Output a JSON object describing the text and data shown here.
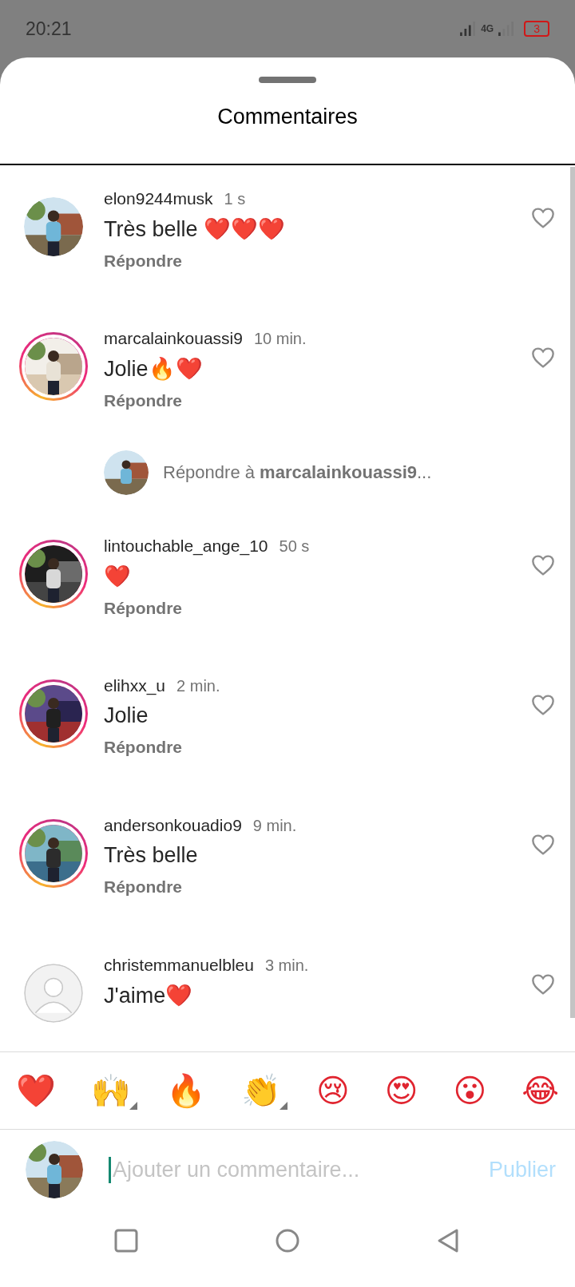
{
  "status_bar": {
    "time": "20:21",
    "network": "4G",
    "battery": "3"
  },
  "sheet": {
    "title": "Commentaires"
  },
  "comments": [
    {
      "username": "elon9244musk",
      "time": "1 s",
      "text": "Très belle ❤️❤️❤️",
      "reply": "Répondre",
      "kind": "picture",
      "story_ring": false,
      "liked": false
    },
    {
      "username": "marcalainkouassi9",
      "time": "10 min.",
      "text": "Jolie🔥❤️",
      "reply": "Répondre",
      "kind": "picture",
      "story_ring": true,
      "liked": false,
      "reply_prompt": "Répondre à **marcalainkouassi9**..."
    },
    {
      "username": "lintouchable_ange_10",
      "time": "50 s",
      "text": "❤️",
      "reply": "Répondre",
      "kind": "picture",
      "story_ring": true,
      "liked": false
    },
    {
      "username": "elihxx_u",
      "time": "2 min.",
      "text": "Jolie",
      "reply": "Répondre",
      "kind": "picture",
      "story_ring": true,
      "liked": false
    },
    {
      "username": "andersonkouadio9",
      "time": "9 min.",
      "text": "Très belle",
      "reply": "Répondre",
      "kind": "picture",
      "story_ring": true,
      "liked": false
    },
    {
      "username": "christemmanuelbleu",
      "time": "3 min.",
      "text": "J'aime❤️",
      "kind": "placeholder",
      "story_ring": false,
      "liked": false
    }
  ],
  "emoji_bar": [
    {
      "emoji": "❤️",
      "variants": false
    },
    {
      "emoji": "🙌",
      "variants": true
    },
    {
      "emoji": "🔥",
      "variants": false
    },
    {
      "emoji": "👏",
      "variants": true
    },
    {
      "emoji": "😢",
      "variants": false
    },
    {
      "emoji": "😍",
      "variants": false
    },
    {
      "emoji": "😮",
      "variants": false
    },
    {
      "emoji": "😂",
      "variants": false
    }
  ],
  "composer": {
    "placeholder": "Ajouter un commentaire...",
    "button": "Publier",
    "disabled": true
  }
}
